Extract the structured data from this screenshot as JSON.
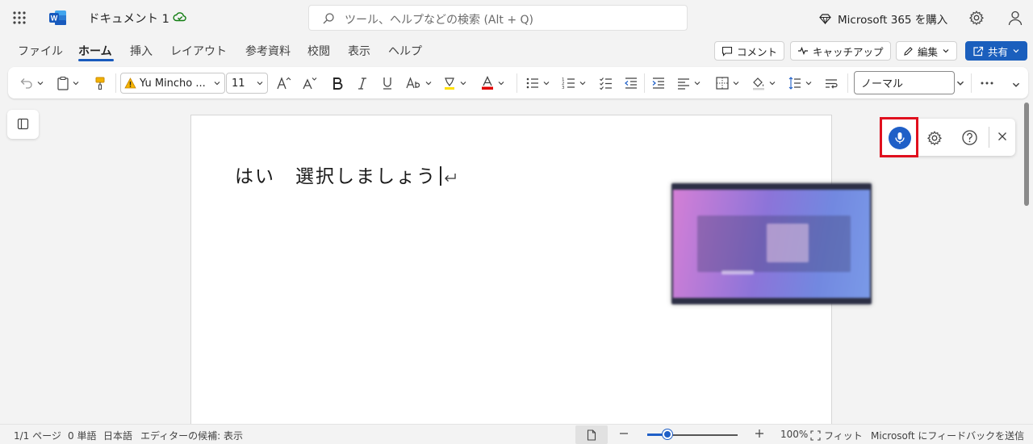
{
  "app": {
    "doc_title": "ドキュメント 1",
    "search_placeholder": "ツール、ヘルプなどの検索 (Alt + Q)",
    "buy_label": "Microsoft 365 を購入"
  },
  "tabs": [
    {
      "label": "ファイル",
      "active": false
    },
    {
      "label": "ホーム",
      "active": true
    },
    {
      "label": "挿入",
      "active": false
    },
    {
      "label": "レイアウト",
      "active": false
    },
    {
      "label": "参考資料",
      "active": false
    },
    {
      "label": "校閲",
      "active": false
    },
    {
      "label": "表示",
      "active": false
    },
    {
      "label": "ヘルプ",
      "active": false
    }
  ],
  "tab_actions": {
    "comment": "コメント",
    "catchup": "キャッチアップ",
    "edit": "編集",
    "share": "共有"
  },
  "ribbon": {
    "font_name": "Yu Mincho ...",
    "font_size": "11",
    "style_name": "ノーマル",
    "font_color": "#e00000",
    "highlight_color": "#ffe000"
  },
  "document": {
    "text": "はい　選択しましょう"
  },
  "colors": {
    "accent": "#185abd",
    "mic_highlight": "#e0101e"
  },
  "status": {
    "page": "1/1 ページ",
    "words": "0 単語",
    "language": "日本語",
    "editor": "エディターの候補: 表示",
    "zoom": "100%",
    "fit": "フィット",
    "feedback": "Microsoft にフィードバックを送信"
  }
}
